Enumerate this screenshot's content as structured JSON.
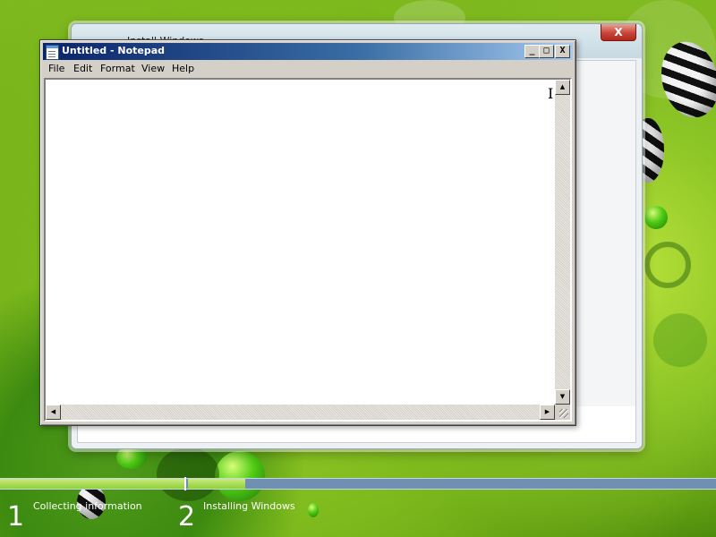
{
  "install_window": {
    "title": "Install Windows",
    "close_label": "X"
  },
  "notepad": {
    "title": "Untitled - Notepad",
    "controls": {
      "minimize": "_",
      "maximize": "□",
      "close": "X"
    },
    "menu": [
      "File",
      "Edit",
      "Format",
      "View",
      "Help"
    ],
    "content": ""
  },
  "setup_progress": {
    "steps": [
      {
        "number": "1",
        "label": "Collecting information"
      },
      {
        "number": "2",
        "label": "Installing Windows"
      }
    ]
  },
  "icons": {
    "cursor": "text-cursor-icon",
    "notepad": "notepad-icon",
    "scroll_up": "arrow-up-icon",
    "scroll_down": "arrow-down-icon",
    "scroll_left": "arrow-left-icon",
    "scroll_right": "arrow-right-icon"
  },
  "colors": {
    "title_gradient_start": "#0a246a",
    "title_gradient_end": "#a6caf0",
    "progress_done": "#8fcf3a",
    "progress_remaining": "#6f8fb3",
    "background_green": "#7fb91f"
  }
}
